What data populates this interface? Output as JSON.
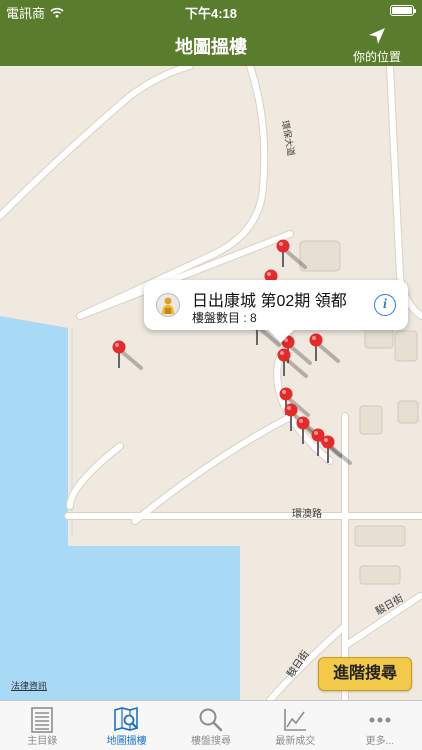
{
  "status": {
    "carrier": "電訊商",
    "time": "下午4:18"
  },
  "nav": {
    "title": "地圖搵樓",
    "location_label": "你的位置"
  },
  "map": {
    "roads": [
      "環保大道",
      "環澳路",
      "駿日街",
      "駿日街"
    ],
    "legal_label": "法律資訊",
    "advanced_search_label": "進階搜尋"
  },
  "callout": {
    "title": "日出康城 第02期 領都",
    "subtitle": "樓盤數目 : 8",
    "info_icon": "info-icon",
    "info_glyph": "i"
  },
  "tabs": [
    {
      "label": "主目錄",
      "icon": "list-icon"
    },
    {
      "label": "地圖搵樓",
      "icon": "map-search-icon"
    },
    {
      "label": "樓盤搜尋",
      "icon": "search-icon"
    },
    {
      "label": "最新成交",
      "icon": "chart-icon"
    },
    {
      "label": "更多...",
      "icon": "more-icon"
    }
  ],
  "colors": {
    "nav_bg": "#5a7d2d",
    "water": "#a9daf5",
    "pin": "#e62a2a",
    "accent": "#1a73c9",
    "button": "#f3c949"
  }
}
